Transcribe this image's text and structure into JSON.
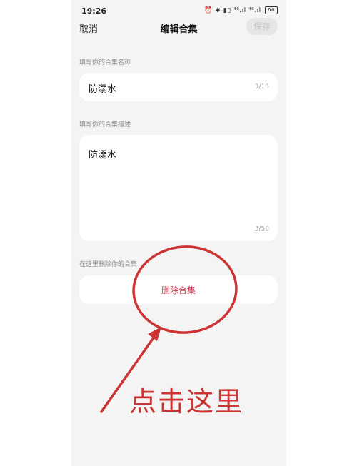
{
  "status_bar": {
    "time": "19:26",
    "icons": "⏰ ✱ ▮▯ ⁴⁶.ıl ⁴⁶.ıl",
    "battery": "66"
  },
  "nav": {
    "cancel_label": "取消",
    "title": "编辑合集",
    "save_label": "保存"
  },
  "name_section": {
    "label": "填写你的合集名称",
    "value": "防溺水",
    "counter": "3/10"
  },
  "desc_section": {
    "label": "填写你的合集描述",
    "value": "防溺水",
    "counter": "3/50"
  },
  "delete_section": {
    "label": "在这里删除你的合集",
    "button_label": "删除合集"
  },
  "annotation": {
    "text": "点击这里",
    "color": "#cc3333"
  }
}
